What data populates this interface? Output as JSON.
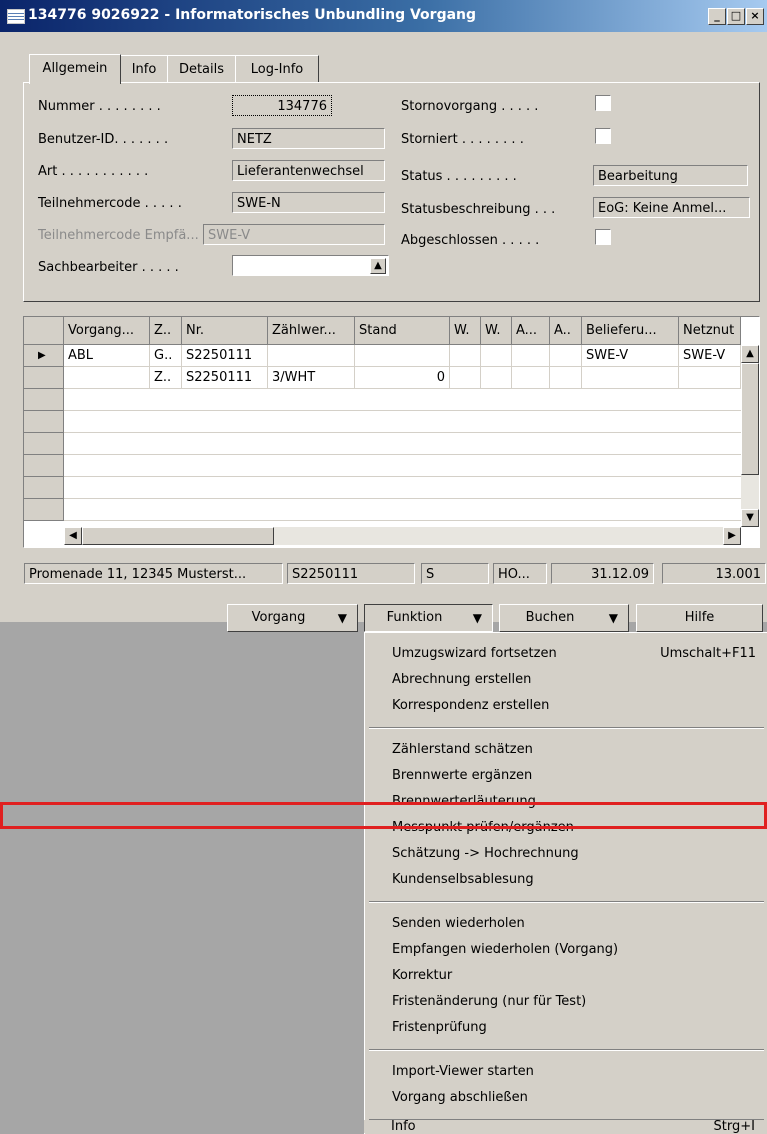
{
  "window": {
    "title": "134776 9026922 - Informatorisches Unbundling Vorgang",
    "minimize": "_",
    "maximize": "□",
    "close": "×"
  },
  "tabs": [
    "Allgemein",
    "Info",
    "Details",
    "Log-Info"
  ],
  "form": {
    "nummer_label": "Nummer . . . . . . . .",
    "nummer_value": "134776",
    "benutzer_label": "Benutzer-ID. . . . . . .",
    "benutzer_value": "NETZ",
    "art_label": "Art . . . . . . . . . . .",
    "art_value": "Lieferantenwechsel",
    "teilnehmer_label": "Teilnehmercode . . . . .",
    "teilnehmer_value": "SWE-N",
    "teilnehmer_empf_label": "Teilnehmercode Empfä...",
    "teilnehmer_empf_value": "SWE-V",
    "sachbearbeiter_label": "Sachbearbeiter . . . . .",
    "sachbearbeiter_value": "",
    "storno_label": "Stornovorgang . . . . .",
    "storniert_label": "Storniert . . . . . . . .",
    "status_label": "Status . . . . . . . . .",
    "status_value": "Bearbeitung",
    "statusbeschr_label": "Statusbeschreibung . . .",
    "statusbeschr_value": "EoG: Keine Anmel...",
    "abgeschlossen_label": "Abgeschlossen . . . . ."
  },
  "grid": {
    "headers": [
      "Vorgang...",
      "Z..",
      "Nr.",
      "Zählwer...",
      "Stand",
      "W.",
      "W.",
      "A...",
      "A..",
      "Belieferu...",
      "Netznut"
    ],
    "rows": [
      [
        "ABL",
        "G..",
        "S2250111",
        "",
        "",
        "",
        "",
        "",
        "",
        "SWE-V",
        "SWE-V"
      ],
      [
        "",
        "Z..",
        "S2250111",
        "3/WHT",
        "0",
        "",
        "",
        "",
        "",
        "",
        ""
      ]
    ]
  },
  "statusbar": [
    "Promenade 11, 12345 Musterst...",
    "S2250111",
    "S",
    "HO...",
    "31.12.09",
    "13.001"
  ],
  "buttons": {
    "vorgang": "Vorgang",
    "funktion": "Funktion",
    "buchen": "Buchen",
    "hilfe": "Hilfe"
  },
  "menu": {
    "items": [
      {
        "label": "Umzugswizard fortsetzen",
        "shortcut": "Umschalt+F11"
      },
      {
        "label": "Abrechnung erstellen",
        "shortcut": ""
      },
      {
        "label": "Korrespondenz erstellen",
        "shortcut": ""
      },
      {
        "label": "Zählerstand schätzen",
        "shortcut": ""
      },
      {
        "label": "Brennwerte ergänzen",
        "shortcut": ""
      },
      {
        "label": "Brennwerterläuterung",
        "shortcut": ""
      },
      {
        "label": "Messpunkt prüfen/ergänzen",
        "shortcut": ""
      },
      {
        "label": "Schätzung -> Hochrechnung",
        "shortcut": ""
      },
      {
        "label": "Kundenselbsablesung",
        "shortcut": ""
      },
      {
        "label": "Senden wiederholen",
        "shortcut": ""
      },
      {
        "label": "Empfangen wiederholen (Vorgang)",
        "shortcut": ""
      },
      {
        "label": "Korrektur",
        "shortcut": ""
      },
      {
        "label": "Fristenänderung (nur für Test)",
        "shortcut": ""
      },
      {
        "label": "Fristenprüfung",
        "shortcut": ""
      },
      {
        "label": "Import-Viewer starten",
        "shortcut": ""
      },
      {
        "label": "Vorgang abschließen",
        "shortcut": ""
      },
      {
        "label": "Info",
        "shortcut": "Strg+I"
      }
    ]
  },
  "colors": {
    "highlight_border": "#e02020",
    "titlebar_start": "#0a246a",
    "face": "#d4d0c8"
  }
}
